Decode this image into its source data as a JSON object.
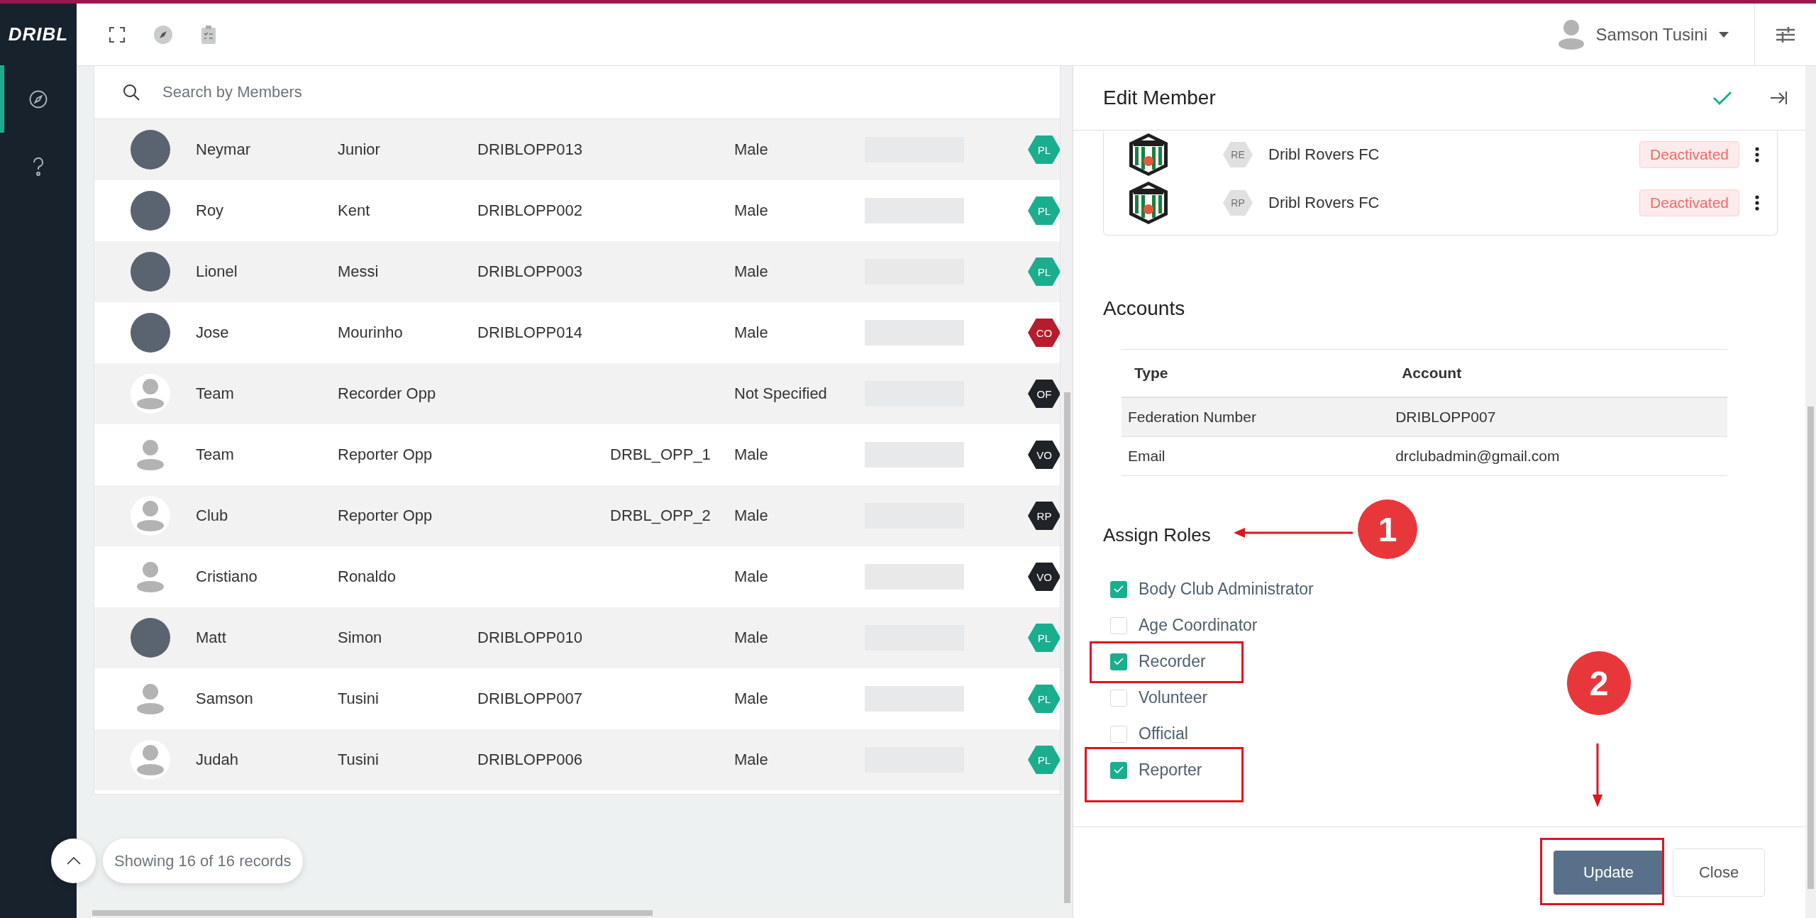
{
  "app": {
    "logo": "DRIBL"
  },
  "sidebar": {
    "items": [
      {
        "kind": "compass",
        "selected": true
      },
      {
        "kind": "help",
        "selected": false
      }
    ]
  },
  "header": {
    "user": "Samson Tusini"
  },
  "search": {
    "placeholder": "Search by Members"
  },
  "members": [
    {
      "first_name": "Neymar",
      "last_name": "Junior",
      "federation_id": "DRIBLOPP013",
      "gender": "Male",
      "kind": "photo",
      "badge": "PL",
      "color": "#1aae8f"
    },
    {
      "first_name": "Roy",
      "last_name": "Kent",
      "federation_id": "DRIBLOPP002",
      "gender": "Male",
      "kind": "photo",
      "badge": "PL",
      "color": "#1aae8f"
    },
    {
      "first_name": "Lionel",
      "last_name": "Messi",
      "federation_id": "DRIBLOPP003",
      "gender": "Male",
      "kind": "photo",
      "badge": "PL",
      "color": "#1aae8f"
    },
    {
      "first_name": "Jose",
      "last_name": "Mourinho",
      "federation_id": "DRIBLOPP014",
      "gender": "Male",
      "kind": "photo",
      "badge": "CO",
      "color": "#b71c2c"
    },
    {
      "first_name": "Team",
      "last_name": "Recorder Opp",
      "gender": "Not Specified",
      "kind": "silhouette",
      "badge": "OF",
      "color": "#1f2328"
    },
    {
      "first_name": "Team",
      "last_name": "Reporter Opp",
      "column_5": "DRBL_OPP_1",
      "gender": "Male",
      "kind": "silhouette",
      "badge": "VO",
      "color": "#1f2328"
    },
    {
      "first_name": "Club",
      "last_name": "Reporter Opp",
      "column_5": "DRBL_OPP_2",
      "gender": "Male",
      "kind": "silhouette",
      "badge": "RP",
      "color": "#1f2328"
    },
    {
      "first_name": "Cristiano",
      "last_name": "Ronaldo",
      "gender": "Male",
      "kind": "silhouette",
      "badge": "VO",
      "color": "#1f2328"
    },
    {
      "first_name": "Matt",
      "last_name": "Simon",
      "federation_id": "DRIBLOPP010",
      "gender": "Male",
      "kind": "photo",
      "badge": "PL",
      "color": "#1aae8f"
    },
    {
      "first_name": "Samson",
      "last_name": "Tusini",
      "federation_id": "DRIBLOPP007",
      "gender": "Male",
      "kind": "silhouette",
      "badge": "PL",
      "color": "#1aae8f"
    },
    {
      "first_name": "Judah",
      "last_name": "Tusini",
      "federation_id": "DRIBLOPP006",
      "gender": "Male",
      "kind": "silhouette",
      "badge": "PL",
      "color": "#1aae8f"
    }
  ],
  "records_label": "Showing 16 of 16 records",
  "edit_panel": {
    "title": "Edit Member",
    "clubs": [
      {
        "role": "RE",
        "name": "Dribl Rovers FC",
        "status": "Deactivated"
      },
      {
        "role": "RP",
        "name": "Dribl Rovers FC",
        "status": "Deactivated"
      }
    ],
    "accounts": {
      "title": "Accounts",
      "columns": [
        "Type",
        "Account"
      ],
      "rows": [
        [
          "Federation Number",
          "DRIBLOPP007"
        ],
        [
          "Email",
          "drclubadmin@gmail.com"
        ]
      ]
    },
    "roles_title": "Assign Roles",
    "roles": [
      {
        "label": "Body Club Administrator",
        "checked": true
      },
      {
        "label": "Age Coordinator",
        "checked": false
      },
      {
        "label": "Recorder",
        "checked": true
      },
      {
        "label": "Volunteer",
        "checked": false
      },
      {
        "label": "Official",
        "checked": false
      },
      {
        "label": "Reporter",
        "checked": true
      }
    ],
    "buttons": [
      {
        "label": "Update",
        "kind": "primary"
      },
      {
        "label": "Close",
        "kind": "secondary"
      }
    ]
  },
  "annotations": [
    {
      "label": "1"
    },
    {
      "label": "2"
    }
  ]
}
